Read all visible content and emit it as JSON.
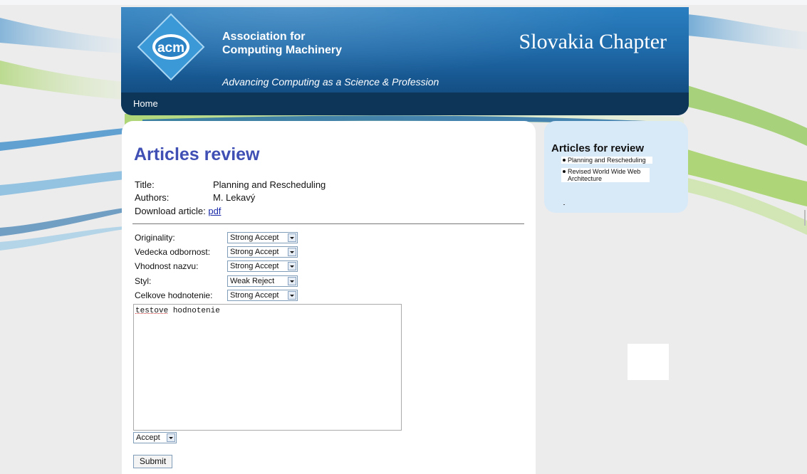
{
  "header": {
    "org_name": "Association for\nComputing Machinery",
    "logo_text": "acm",
    "tagline": "Advancing Computing as a Science & Profession",
    "chapter": "Slovakia Chapter"
  },
  "nav": {
    "home": "Home"
  },
  "main": {
    "title": "Articles review",
    "info": {
      "title_label": "Title:",
      "title_value": "Planning and Rescheduling",
      "authors_label": "Authors:",
      "authors_value": "M. Lekavý",
      "download_label": "Download article:",
      "download_link": "pdf"
    },
    "criteria": [
      {
        "label": "Originality:",
        "value": "Strong Accept"
      },
      {
        "label": "Vedecka odbornost:",
        "value": "Strong Accept"
      },
      {
        "label": "Vhodnost nazvu:",
        "value": "Strong Accept"
      },
      {
        "label": "Styl:",
        "value": "Weak Reject"
      },
      {
        "label": "Celkove hodnotenie:",
        "value": "Strong Accept"
      }
    ],
    "comment_word1": "testove",
    "comment_word2": " hodnotenie",
    "decision": "Accept",
    "submit": "Submit"
  },
  "sidebar": {
    "title": "Articles for review",
    "items": [
      "Planning and Rescheduling",
      "Revised World Wide Web Architecture"
    ]
  },
  "colors": {
    "title_blue": "#3f4fb4",
    "header_blue": "#1f6aa9",
    "nav_dark": "#0c3558",
    "sidebar_bg": "#d8e9f8",
    "link": "#1a2aa8"
  }
}
